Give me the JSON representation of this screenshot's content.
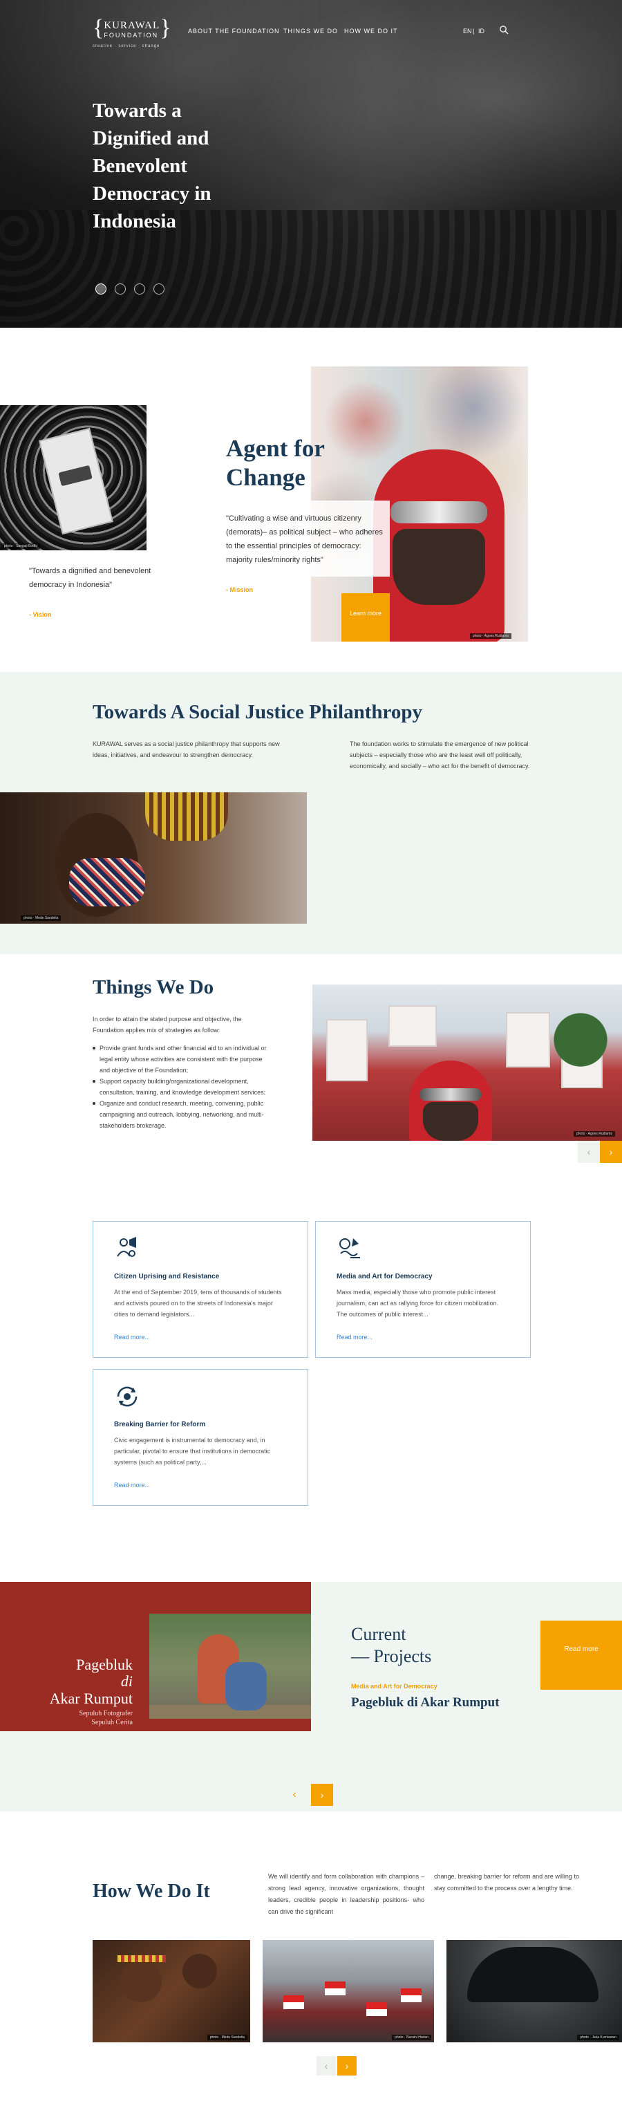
{
  "header": {
    "logo_word": "KURAWAL",
    "logo_sub": "FOUNDATION",
    "logo_tagline": "creative · service · change",
    "nav": [
      "ABOUT THE FOUNDATION",
      "THINGS WE DO",
      "HOW WE DO IT"
    ],
    "lang_en": "EN",
    "lang_id": "ID",
    "lang_sep": "|"
  },
  "hero": {
    "title": "Towards a Dignified and Benevolent Democracy in Indonesia",
    "slides_count": 4,
    "active_slide": 1
  },
  "vision": {
    "quote": "\"Towards a dignified and benevolent democracy in Indonesia\"",
    "label": "- Vision",
    "photo_credit": "photo · Sangaji Bodhi"
  },
  "mission": {
    "heading": "Agent for Change",
    "quote": "\"Cultivating a wise and virtuous citizenry (demorats)– as political subject – who adheres to the essential principles of democracy: majority rules/minority rights\"",
    "label": "- Mission",
    "cta_label": "Learn more",
    "photo_credit": "photo · Agoes Rudianto"
  },
  "social_justice": {
    "title": "Towards A Social Justice Philanthropy",
    "left_text": "KURAWAL serves as a social justice philanthropy that supports new ideas, initiatives, and endeavour to strengthen democracy.",
    "right_text": "The foundation works to stimulate the emergence of new political subjects – especially those who are the least well off politically, economically, and socially – who act for the benefit of democracy.",
    "photo_credit": "photo · Mede Sandelia"
  },
  "things_we_do": {
    "title": "Things We Do",
    "intro": "In order to attain the stated purpose and objective, the Foundation applies mix of strategies as follow:",
    "items": [
      "Provide grant funds and other financial aid to an individual or legal entity whose activities are consistent with the purpose and objective of the Foundation;",
      "Support capacity building/organizational development, consultation, training, and knowledge development services;",
      "Organize and conduct research, meeting, convening, public campaigning and outreach, lobbying, networking, and multi-stakeholders brokerage."
    ],
    "photo_credit": "photo · Agoes Rudianto",
    "prev_icon": "‹",
    "next_icon": "›"
  },
  "cards": [
    {
      "icon": "megaphone-people-icon",
      "title": "Citizen Uprising and Resistance",
      "text": "At the end of September 2019, tens of thousands of students and activists poured on to the streets of Indonesia's major cities to demand legislators...",
      "more": "Read more..."
    },
    {
      "icon": "media-art-icon",
      "title": "Media and Art for Democracy",
      "text": "Mass media, especially those who promote public interest journalism, can act as rallying force for citizen mobilization. The outcomes of public interest...",
      "more": "Read more..."
    },
    {
      "icon": "reform-cycle-icon",
      "title": "Breaking Barrier for Reform",
      "text": "Civic engagement is instrumental to democracy and, in particular, pivotal to ensure that institutions in democratic systems (such as political party,...",
      "more": "Read more..."
    }
  ],
  "current_projects": {
    "poster_line1": "Pagebluk",
    "poster_line2": "di",
    "poster_line3": "Akar Rumput",
    "poster_sub1": "Sepuluh Fotografer",
    "poster_sub2": "Sepuluh Cerita",
    "title_line1": "Current",
    "title_line2": "— Projects",
    "category": "Media and Art for Democracy",
    "project_name": "Pagebluk di Akar Rumput",
    "read_label": "Read more",
    "prev_icon": "‹",
    "next_icon": "›"
  },
  "how_we_do_it": {
    "title": "How We Do It",
    "left_text": "We will identify and form collaboration with champions – strong lead agency, innovative organizations, thought leaders, credible people in leadership positions- who can drive the significant",
    "right_text": "change, breaking barrier for reform and are willing to stay committed to the process over a lengthy time.",
    "photo_credits": [
      "photo · Mede Sandelia",
      "photo · Nuraini Harian",
      "photo · Jaka Kurniawan"
    ],
    "prev_icon": "‹",
    "next_icon": "›"
  }
}
